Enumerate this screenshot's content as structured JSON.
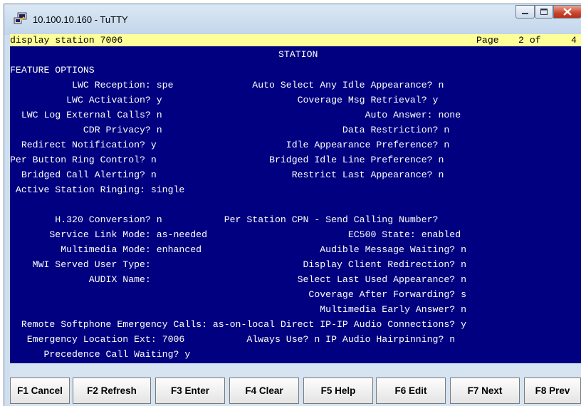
{
  "window": {
    "title": "10.100.10.160 - TuTTY"
  },
  "colors": {
    "terminal_bg": "#000080",
    "terminal_fg": "#ffffff",
    "highlight_bg": "#ffff99"
  },
  "terminal": {
    "command": "display station 7006",
    "page_label": "Page",
    "page_number": "2 of",
    "page_total": "4",
    "screen_title": "STATION",
    "section": "FEATURE OPTIONS",
    "lines": [
      "           LWC Reception: spe              Auto Select Any Idle Appearance? n",
      "          LWC Activation? y                        Coverage Msg Retrieval? y",
      "  LWC Log External Calls? n                                    Auto Answer: none",
      "             CDR Privacy? n                                Data Restriction? n",
      "  Redirect Notification? y                       Idle Appearance Preference? n",
      "Per Button Ring Control? n                    Bridged Idle Line Preference? n",
      "  Bridged Call Alerting? n                        Restrict Last Appearance? n",
      " Active Station Ringing: single",
      "",
      "        H.320 Conversion? n           Per Station CPN - Send Calling Number?",
      "       Service Link Mode: as-needed                         EC500 State: enabled",
      "         Multimedia Mode: enhanced                     Audible Message Waiting? n",
      "    MWI Served User Type:                           Display Client Redirection? n",
      "              AUDIX Name:                          Select Last Used Appearance? n",
      "                                                     Coverage After Forwarding? s",
      "                                                       Multimedia Early Answer? n",
      "  Remote Softphone Emergency Calls: as-on-local Direct IP-IP Audio Connections? y",
      "   Emergency Location Ext: 7006           Always Use? n IP Audio Hairpinning? n",
      "      Precedence Call Waiting? y"
    ]
  },
  "fkeys": [
    {
      "id": "f1",
      "label": "F1 Cancel"
    },
    {
      "id": "f2",
      "label": "F2 Refresh"
    },
    {
      "id": "f3",
      "label": "F3 Enter"
    },
    {
      "id": "f4",
      "label": "F4 Clear"
    },
    {
      "id": "f5",
      "label": "F5 Help"
    },
    {
      "id": "f6",
      "label": "F6 Edit"
    },
    {
      "id": "f7",
      "label": "F7 Next"
    },
    {
      "id": "f8",
      "label": "F8 Prev"
    }
  ]
}
